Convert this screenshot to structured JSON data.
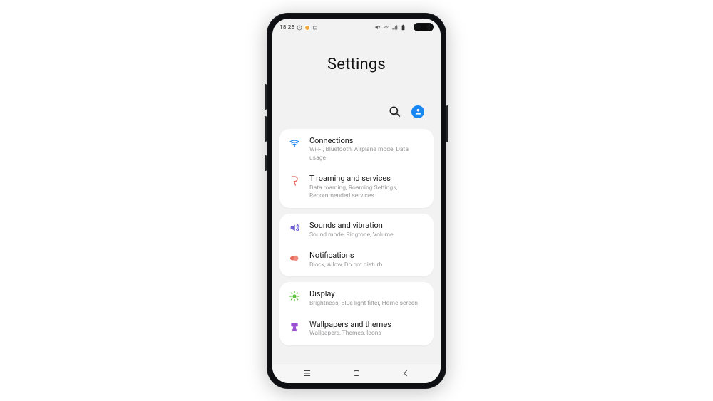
{
  "status": {
    "time": "18:25",
    "left_icons": [
      "clock-icon",
      "dot-orange-icon",
      "rect-icon"
    ],
    "right_icons": [
      "mute-icon",
      "wifi-icon",
      "signal-icon",
      "battery-icon"
    ]
  },
  "header": {
    "title": "Settings"
  },
  "actions": {
    "search": "search",
    "account": "account"
  },
  "groups": [
    {
      "items": [
        {
          "icon": "wifi-icon",
          "icon_color": "#1a87f0",
          "title": "Connections",
          "subtitle": "Wi-Fi, Bluetooth, Airplane mode, Data usage"
        },
        {
          "icon": "roaming-icon",
          "icon_color": "#e4645a",
          "title": "T roaming and services",
          "subtitle": "Data roaming, Roaming Settings, Recommended services"
        }
      ]
    },
    {
      "items": [
        {
          "icon": "sound-icon",
          "icon_color": "#6a5cd6",
          "title": "Sounds and vibration",
          "subtitle": "Sound mode, Ringtone, Volume"
        },
        {
          "icon": "notifications-icon",
          "icon_color": "#e76a5a",
          "title": "Notifications",
          "subtitle": "Block, Allow, Do not disturb"
        }
      ]
    },
    {
      "items": [
        {
          "icon": "display-icon",
          "icon_color": "#5fbf3b",
          "title": "Display",
          "subtitle": "Brightness, Blue light filter, Home screen"
        },
        {
          "icon": "wallpapers-icon",
          "icon_color": "#9a4fd1",
          "title": "Wallpapers and themes",
          "subtitle": "Wallpapers, Themes, Icons"
        }
      ]
    }
  ],
  "nav": {
    "recents": "recents",
    "home": "home",
    "back": "back"
  }
}
